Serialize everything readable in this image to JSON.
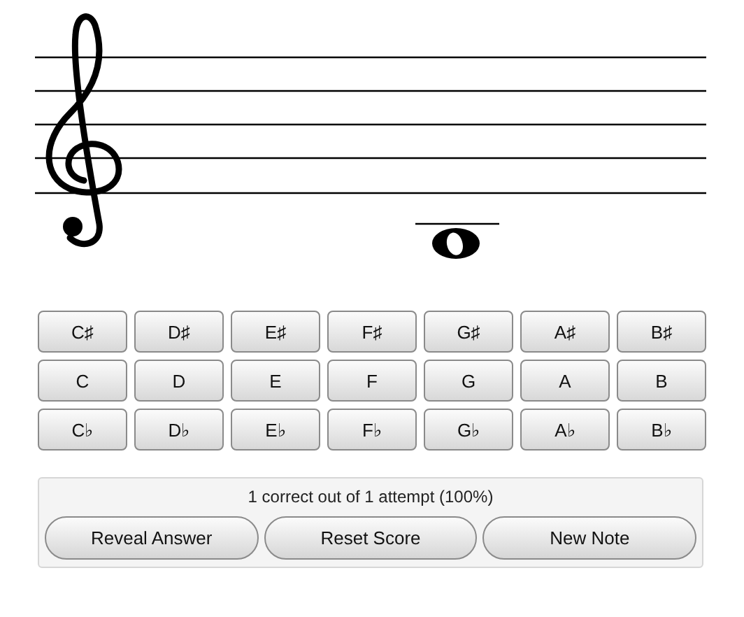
{
  "note_buttons": [
    {
      "row": [
        "C♯",
        "D♯",
        "E♯",
        "F♯",
        "G♯",
        "A♯",
        "B♯"
      ]
    },
    {
      "row": [
        "C",
        "D",
        "E",
        "F",
        "G",
        "A",
        "B"
      ]
    },
    {
      "row": [
        "C♭",
        "D♭",
        "E♭",
        "F♭",
        "G♭",
        "A♭",
        "B♭"
      ]
    }
  ],
  "score": {
    "text": "1 correct out of 1 attempt (100%)",
    "buttons": [
      "Reveal Answer",
      "Reset Score",
      "New Note"
    ]
  }
}
